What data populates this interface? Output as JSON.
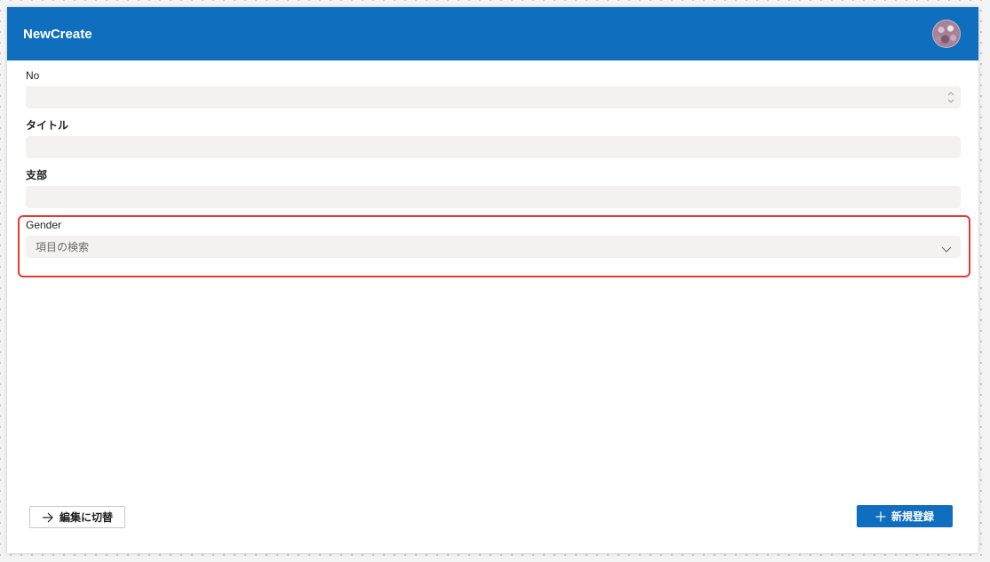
{
  "app": {
    "title": "NewCreate",
    "accent_color": "#106ebe",
    "avatar_icon": "user-avatar"
  },
  "form": {
    "fields": [
      {
        "label": "No",
        "value": "",
        "type": "number"
      },
      {
        "label": "タイトル",
        "value": "",
        "type": "text"
      },
      {
        "label": "支部",
        "value": "",
        "type": "text"
      },
      {
        "label": "Gender",
        "value": "",
        "placeholder": "項目の検索",
        "type": "combobox"
      }
    ],
    "highlight_color": "#e53935"
  },
  "footer": {
    "switch_button_label": "編集に切替",
    "switch_button_icon": "arrow-right-icon",
    "create_button_label": "新規登録",
    "create_button_icon": "plus-icon"
  }
}
